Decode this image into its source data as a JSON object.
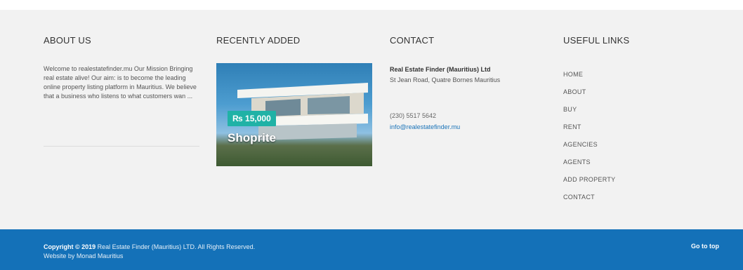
{
  "about": {
    "heading": "ABOUT US",
    "text": "Welcome to realestatefinder.mu Our Mission Bringing real estate alive! Our aim: is to become the leading online property listing platform in Mauritius. We believe that a business who listens to what customers wan ..."
  },
  "recent": {
    "heading": "RECENTLY ADDED",
    "property": {
      "price": "₨ 15,000",
      "title": "Shoprite"
    }
  },
  "contact": {
    "heading": "CONTACT",
    "company": "Real Estate Finder (Mauritius) Ltd",
    "address": "St Jean Road, Quatre Bornes Mauritius",
    "phone": "(230) 5517 5642",
    "email": "info@realestatefinder.mu"
  },
  "links": {
    "heading": "USEFUL LINKS",
    "items": [
      "HOME",
      "ABOUT",
      "BUY",
      "RENT",
      "AGENCIES",
      "AGENTS",
      "ADD PROPERTY",
      "CONTACT"
    ]
  },
  "bottom": {
    "copyright_prefix": "Copyright © 2019",
    "copyright_company": "Real Estate Finder (Mauritius) LTD. All Rights Reserved.",
    "website_by": "Website by Monad Mauritius",
    "go_top": "Go to top"
  },
  "colors": {
    "footer_bg": "#f2f2f2",
    "bar_bg": "#1471b8",
    "badge": "#20b2a6",
    "link": "#1a73b8"
  }
}
